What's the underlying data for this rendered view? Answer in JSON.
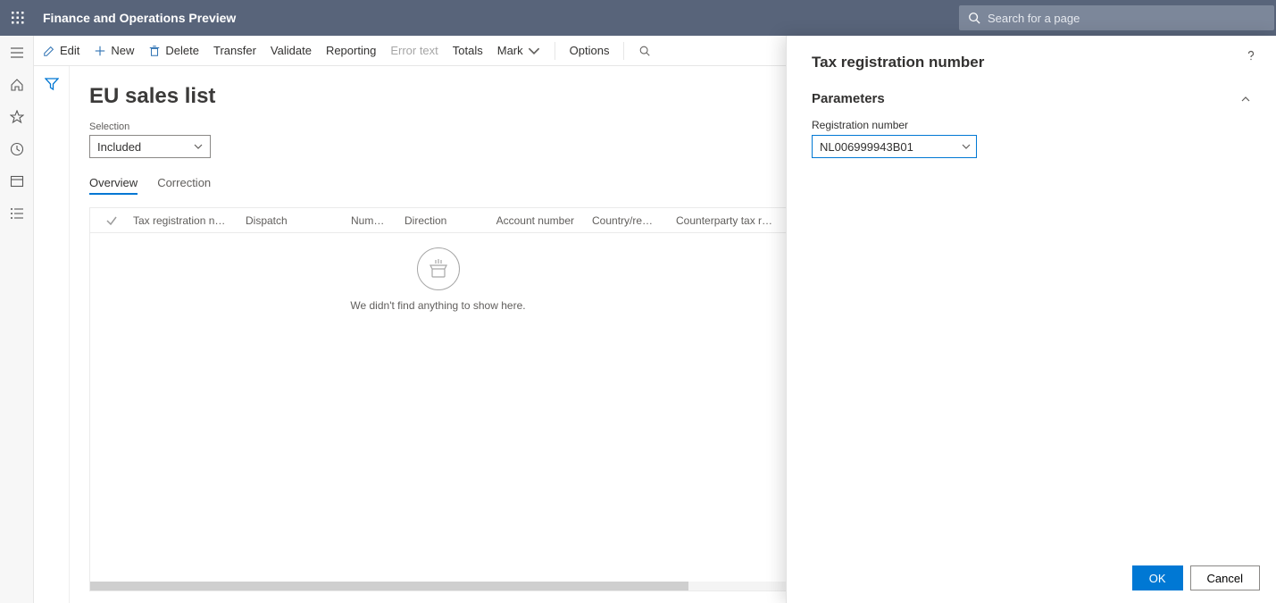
{
  "header": {
    "app_title": "Finance and Operations Preview",
    "search_placeholder": "Search for a page"
  },
  "toolbar": {
    "edit": "Edit",
    "new": "New",
    "delete": "Delete",
    "transfer": "Transfer",
    "validate": "Validate",
    "reporting": "Reporting",
    "error_text": "Error text",
    "totals": "Totals",
    "mark": "Mark",
    "options": "Options"
  },
  "page": {
    "title": "EU sales list",
    "selection_label": "Selection",
    "selection_value": "Included",
    "tabs": {
      "overview": "Overview",
      "correction": "Correction"
    },
    "empty_msg": "We didn't find anything to show here."
  },
  "columns": {
    "tax_reg": "Tax registration number",
    "dispatch": "Dispatch",
    "number": "Number",
    "direction": "Direction",
    "account": "Account number",
    "country": "Country/region",
    "counterparty": "Counterparty tax registration"
  },
  "dialog": {
    "title": "Tax registration number",
    "section": "Parameters",
    "field_label": "Registration number",
    "field_value": "NL006999943B01",
    "ok": "OK",
    "cancel": "Cancel"
  }
}
